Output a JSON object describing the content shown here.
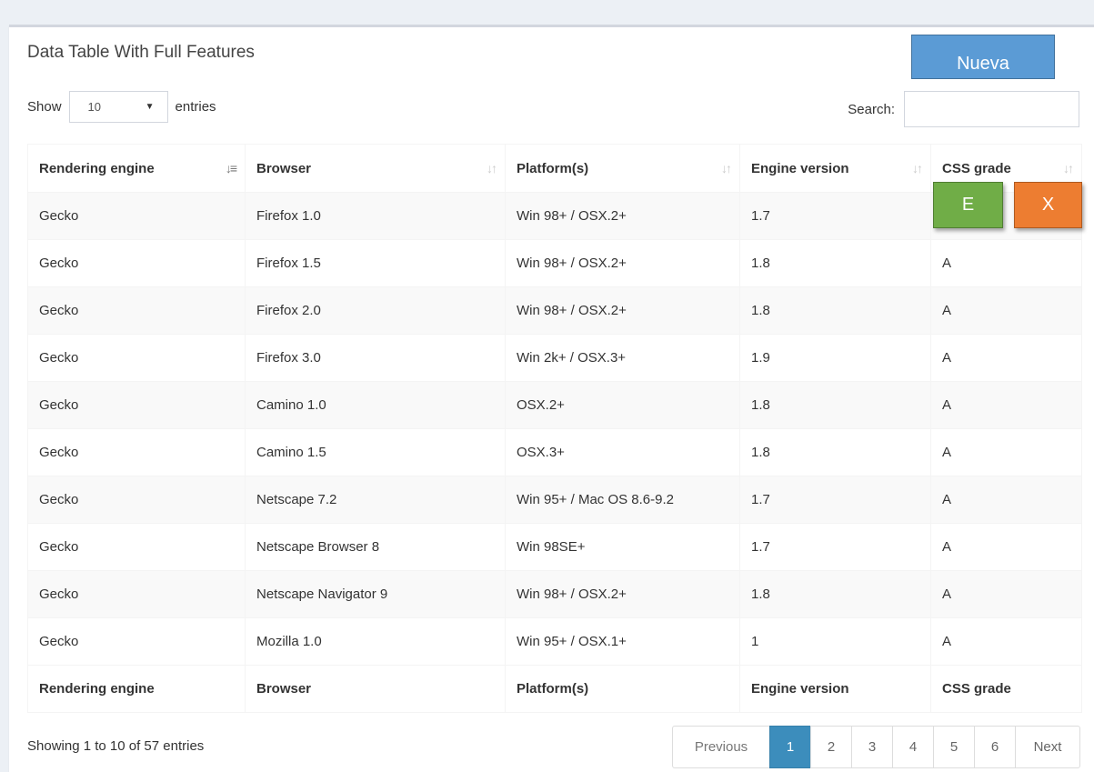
{
  "box": {
    "title": "Data Table With Full Features"
  },
  "new_button": {
    "label": "Nueva",
    "color": "#5b9bd5"
  },
  "length": {
    "show_label": "Show",
    "selected": "10",
    "entries_label": "entries"
  },
  "search": {
    "label": "Search:",
    "value": ""
  },
  "table": {
    "columns": [
      "Rendering engine",
      "Browser",
      "Platform(s)",
      "Engine version",
      "CSS grade"
    ],
    "sort_column": "Rendering engine",
    "rows": [
      [
        "Gecko",
        "Firefox 1.0",
        "Win 98+ / OSX.2+",
        "1.7",
        ""
      ],
      [
        "Gecko",
        "Firefox 1.5",
        "Win 98+ / OSX.2+",
        "1.8",
        "A"
      ],
      [
        "Gecko",
        "Firefox 2.0",
        "Win 98+ / OSX.2+",
        "1.8",
        "A"
      ],
      [
        "Gecko",
        "Firefox 3.0",
        "Win 2k+ / OSX.3+",
        "1.9",
        "A"
      ],
      [
        "Gecko",
        "Camino 1.0",
        "OSX.2+",
        "1.8",
        "A"
      ],
      [
        "Gecko",
        "Camino 1.5",
        "OSX.3+",
        "1.8",
        "A"
      ],
      [
        "Gecko",
        "Netscape 7.2",
        "Win 95+ / Mac OS 8.6-9.2",
        "1.7",
        "A"
      ],
      [
        "Gecko",
        "Netscape Browser 8",
        "Win 98SE+",
        "1.7",
        "A"
      ],
      [
        "Gecko",
        "Netscape Navigator 9",
        "Win 98+ / OSX.2+",
        "1.8",
        "A"
      ],
      [
        "Gecko",
        "Mozilla 1.0",
        "Win 95+ / OSX.1+",
        "1",
        "A"
      ]
    ]
  },
  "actions": {
    "edit_label": "E",
    "edit_color": "#70ad47",
    "delete_label": "X",
    "delete_color": "#ed7d31"
  },
  "info": "Showing 1 to 10 of 57 entries",
  "pagination": {
    "previous": "Previous",
    "pages": [
      "1",
      "2",
      "3",
      "4",
      "5",
      "6"
    ],
    "current": "1",
    "next": "Next"
  }
}
